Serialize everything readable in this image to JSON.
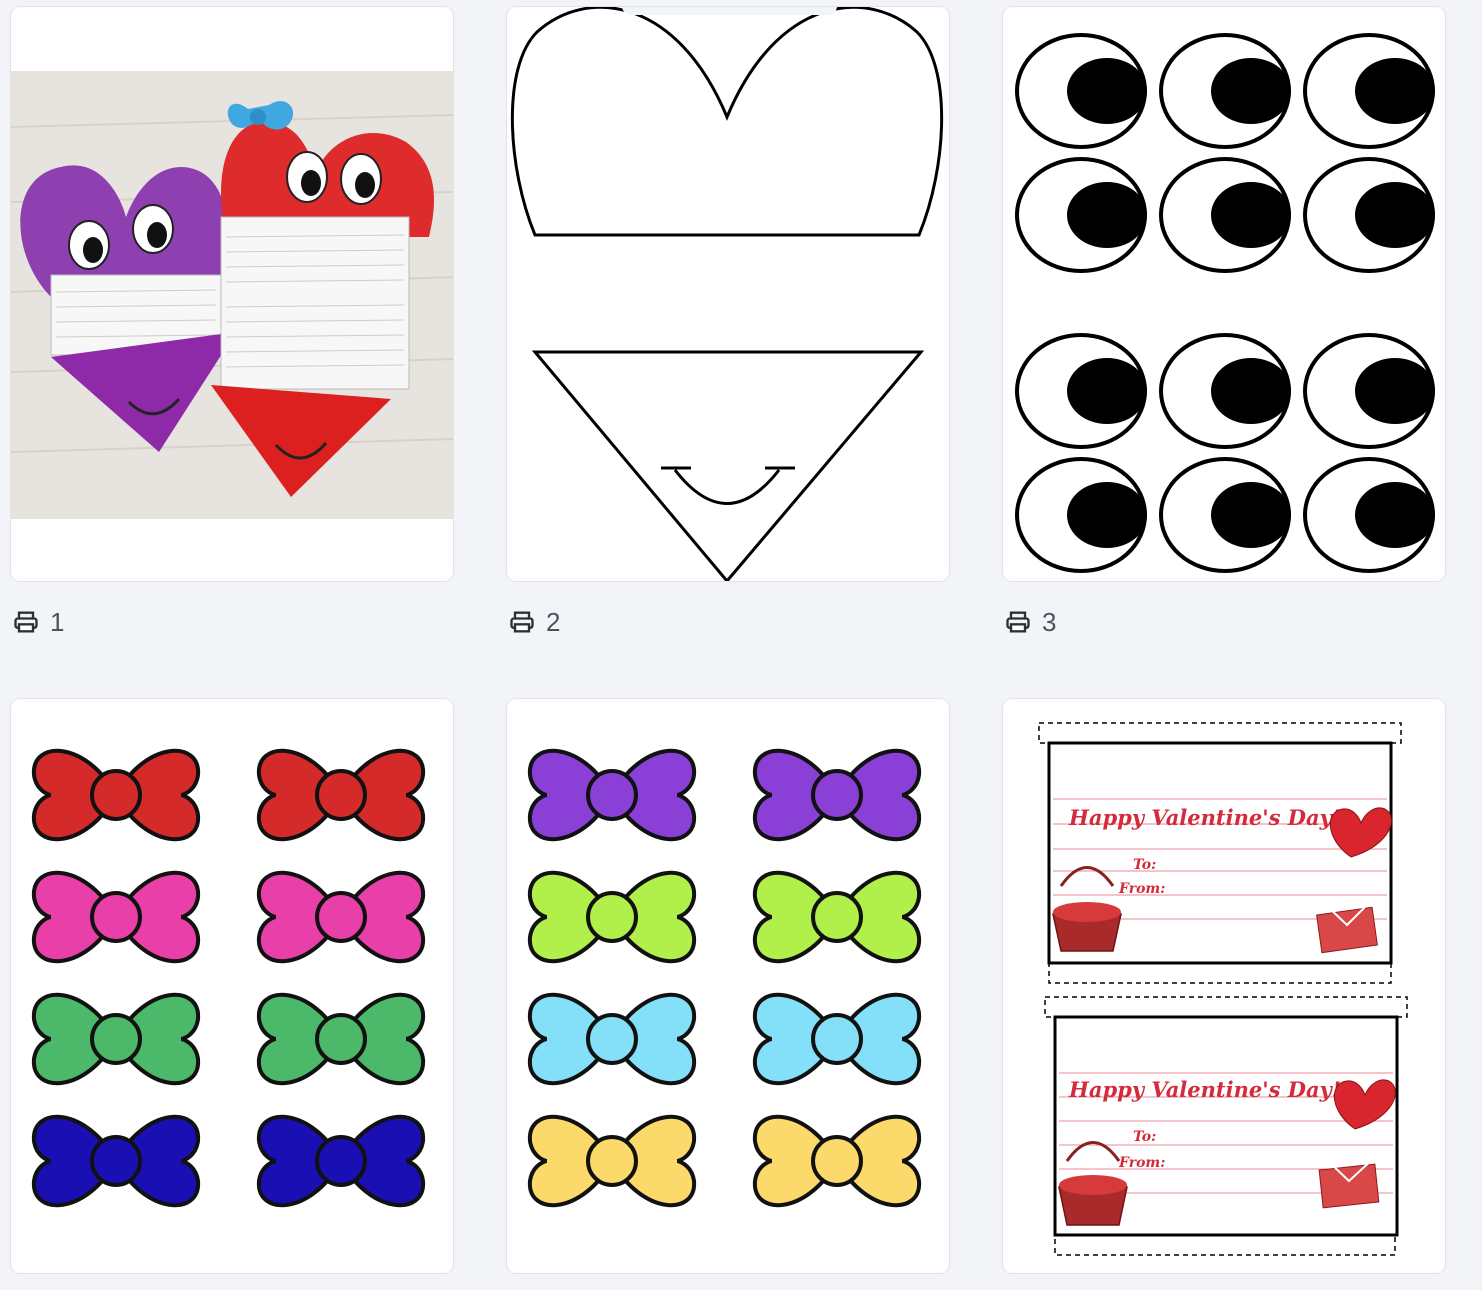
{
  "pages": [
    {
      "number": "1"
    },
    {
      "number": "2"
    },
    {
      "number": "3"
    }
  ],
  "tag_card": {
    "greeting": "Happy Valentine's Day!",
    "to_label": "To:",
    "from_label": "From:"
  },
  "icons": {
    "print": "printer-icon"
  },
  "colors": {
    "background": "#f2f4f8",
    "card": "#ffffff",
    "red": "#d42a2a",
    "pink": "#e93fa9",
    "green": "#4cb86a",
    "blue": "#1a0fb2",
    "purple": "#8a3fd6",
    "lime": "#b1f04a",
    "sky": "#84e0f8",
    "yellow": "#fbd96a",
    "text_red": "#d42a3b"
  }
}
